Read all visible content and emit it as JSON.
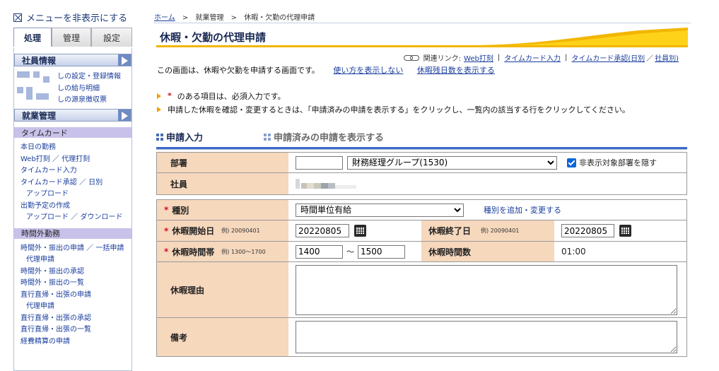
{
  "sidebar": {
    "hide_menu_label": "メニューを非表示にする",
    "tabs": [
      {
        "label": "処理",
        "active": true
      },
      {
        "label": "管理",
        "active": false
      },
      {
        "label": "設定",
        "active": false
      }
    ],
    "employee_section": {
      "title": "社員情報",
      "links": [
        "しの設定・登録情報",
        "しの給与明細",
        "しの源泉徴収票"
      ]
    },
    "work_section": {
      "title": "就業管理",
      "timecard_header": "タイムカード",
      "timecard_links": [
        {
          "text": "本日の勤務",
          "indent": false
        },
        {
          "text": "Web打刻 ／ 代理打刻",
          "indent": false
        },
        {
          "text": "タイムカード入力",
          "indent": false
        },
        {
          "text": "タイムカード承認 ／ 日別",
          "indent": false
        },
        {
          "text": "アップロード",
          "indent": true
        },
        {
          "text": "出勤予定の作成",
          "indent": false
        },
        {
          "text": "アップロード ／ ダウンロード",
          "indent": true
        }
      ],
      "overtime_header": "時間外勤務",
      "overtime_links": [
        {
          "text": "時間外・振出の申請 ／ 一括申請",
          "indent": false
        },
        {
          "text": "代理申請",
          "indent": true
        },
        {
          "text": "時間外・振出の承認",
          "indent": false
        },
        {
          "text": "時間外・振出の一覧",
          "indent": false
        },
        {
          "text": "直行直帰・出張の申請",
          "indent": false
        },
        {
          "text": "代理申請",
          "indent": true
        },
        {
          "text": "直行直帰・出張の承認",
          "indent": false
        },
        {
          "text": "直行直帰・出張の一覧",
          "indent": false
        },
        {
          "text": "経費精算の申請",
          "indent": false
        }
      ]
    }
  },
  "breadcrumb": {
    "home": "ホーム",
    "sep": ">",
    "mid": "就業管理",
    "current": "休暇・欠勤の代理申請"
  },
  "page_title": "休暇・欠勤の代理申請",
  "related_links": {
    "label": "関連リンク:",
    "links": [
      "Web打刻",
      "タイムカード入力",
      "タイムカード承認(日別",
      "社員別)"
    ],
    "separators": [
      "|",
      "|",
      "／"
    ]
  },
  "description": {
    "text": "この画面は、休暇や欠勤を申請する画面です。",
    "link_usage": "使い方を表示しない",
    "link_remaining": "休暇残日数を表示する"
  },
  "notes": {
    "required_mark": "*",
    "required_text": "のある項目は、必須入力です。",
    "confirm_text": "申請した休暇を確認・変更するときは、「申請済みの申請を表示する」をクリックし、一覧内の該当する行をクリックしてください。"
  },
  "section_tabs": {
    "input_tab": "申請入力",
    "submitted_tab": "申請済みの申請を表示する"
  },
  "form": {
    "department": {
      "label": "部署",
      "code_value": "",
      "selected": "財務経理グループ(1530)",
      "hide_checkbox_label": "非表示対象部署を隠す",
      "hide_checked": true
    },
    "employee": {
      "label": "社員"
    },
    "type": {
      "label": "種別",
      "required": "*",
      "selected": "時間単位有給",
      "edit_link": "種別を追加・変更する"
    },
    "start_date": {
      "label": "休暇開始日",
      "required": "*",
      "example": "例) 20090401",
      "value": "20220805"
    },
    "end_date": {
      "label": "休暇終了日",
      "example": "例) 20090401",
      "value": "20220805"
    },
    "time_range": {
      "label": "休暇時間帯",
      "required": "*",
      "example": "例) 1300〜1700",
      "from": "1400",
      "tilde": "〜",
      "to": "1500"
    },
    "hours": {
      "label": "休暇時間数",
      "value": "01:00"
    },
    "reason": {
      "label": "休暇理由",
      "value": ""
    },
    "remarks": {
      "label": "備考",
      "value": ""
    }
  },
  "colors": {
    "label_bg": "#f6d8bd",
    "accent_blue": "#3f69c6",
    "accent_yellow": "#f2b600",
    "link": "#1a3d9c",
    "required": "#d0102a"
  }
}
